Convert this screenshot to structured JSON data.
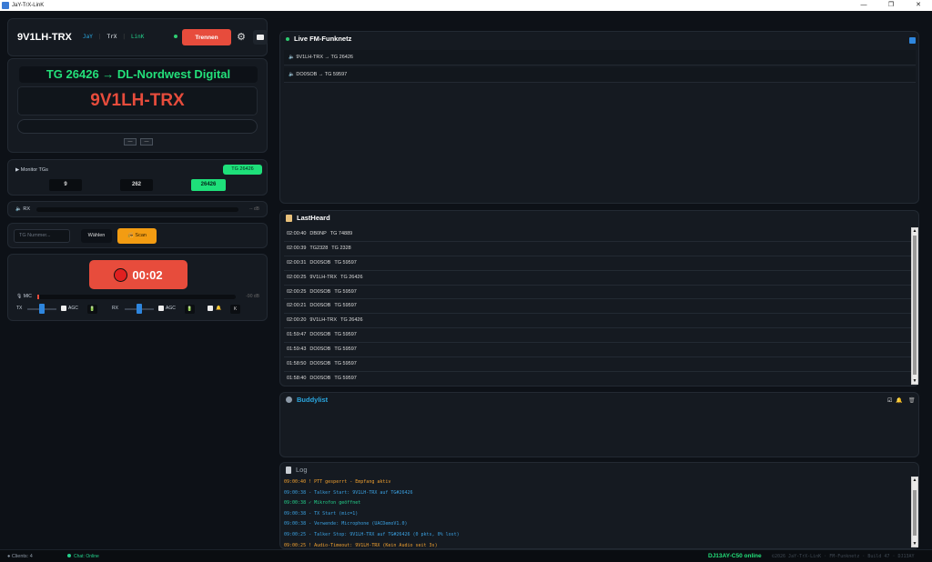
{
  "window": {
    "title": "JaY-TrX-LinK",
    "controls": [
      "—",
      "❐",
      "✕"
    ]
  },
  "header": {
    "callsign": "9V1LH-TRX",
    "brand": [
      "JaY",
      "TrX",
      "LinK"
    ],
    "disconnect_label": "Trennen",
    "accent": "#e74c3c"
  },
  "display": {
    "tg_line": "TG 26426 → DL-Nordwest Digital",
    "callsign": "9V1LH-TRX",
    "buttons": [
      "—",
      "—"
    ]
  },
  "monitor": {
    "label": "Monitor TGs",
    "active_tg": "TG 26426",
    "tgs": [
      "9",
      "262",
      "26426"
    ]
  },
  "rx": {
    "label": "RX",
    "db": "-- dB"
  },
  "tg_input": {
    "placeholder": "TG Nummer...",
    "select_label": "Wählen",
    "scan_label": "Scan"
  },
  "ptt": {
    "time": "00:02",
    "mic_label": "MIC",
    "mic_db": "-90 dB",
    "mic_level": 0.01,
    "tx_label": "TX",
    "rx_label": "RX",
    "agc_label": "AGC",
    "k_label": "K"
  },
  "live": {
    "title": "Live FM-Funknetz",
    "rows": [
      "9V1LH-TRX → TG 26426",
      "DO0SOB → TG 59597"
    ]
  },
  "lastheard": {
    "title": "LastHeard",
    "rows": [
      {
        "time": "02:00:40",
        "call": "DB0NP",
        "tg": "TG 74889"
      },
      {
        "time": "02:00:39",
        "call": "TG2328",
        "tg": "TG 2328"
      },
      {
        "time": "02:00:31",
        "call": "DO0SOB",
        "tg": "TG 59597"
      },
      {
        "time": "02:00:25",
        "call": "9V1LH-TRX",
        "tg": "TG 26426"
      },
      {
        "time": "02:00:25",
        "call": "DO0SOB",
        "tg": "TG 59597"
      },
      {
        "time": "02:00:21",
        "call": "DO0SOB",
        "tg": "TG 59597"
      },
      {
        "time": "02:00:20",
        "call": "9V1LH-TRX",
        "tg": "TG 26426"
      },
      {
        "time": "01:59:47",
        "call": "DO0SOB",
        "tg": "TG 59597"
      },
      {
        "time": "01:59:43",
        "call": "DO0SOB",
        "tg": "TG 59597"
      },
      {
        "time": "01:58:50",
        "call": "DO0SOB",
        "tg": "TG 59597"
      },
      {
        "time": "01:58:40",
        "call": "DO0SOB",
        "tg": "TG 59597"
      }
    ]
  },
  "buddylist": {
    "title": "Buddylist"
  },
  "log": {
    "title": "Log",
    "rows": [
      {
        "text": "09:00:40 ! PTT gesperrt - Empfang aktiv",
        "color": "#f0a030"
      },
      {
        "text": "09:00:38 - Talker Start: 9V1LH-TRX auf TG#26426",
        "color": "#3aa0e0"
      },
      {
        "text": "09:00:38 ✓ Mikrofon geöffnet",
        "color": "#23d18b"
      },
      {
        "text": "09:00:38 - TX Start (mic=1)",
        "color": "#3aa0e0"
      },
      {
        "text": "09:00:38 - Verwende: Microphone (UACDemoV1.0)",
        "color": "#3aa0e0"
      },
      {
        "text": "09:00:25 - Talker Stop: 9V1LH-TRX auf TG#26426 (0 pkts, 0% lost)",
        "color": "#3aa0e0"
      },
      {
        "text": "09:00:25 ! Audio-Timeout: 9V1LH-TRX (Kein Audio seit 3s)",
        "color": "#f0a030"
      }
    ]
  },
  "status": {
    "clients": "Clients: 4",
    "chat": "Chat: Online",
    "online_user": "DJ13AY-C50 online",
    "version": "©2026 JaY-TrX-LinK · FM-Funknetz · Build 47 · DJ13AY"
  }
}
